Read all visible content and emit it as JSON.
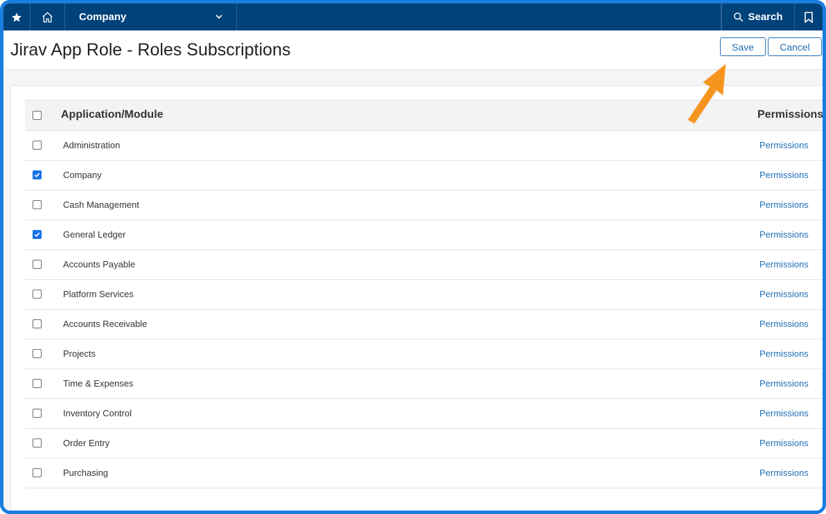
{
  "topbar": {
    "company_label": "Company",
    "search_label": "Search"
  },
  "header": {
    "title": "Jirav App Role - Roles Subscriptions",
    "save_label": "Save",
    "cancel_label": "Cancel"
  },
  "table": {
    "columns": [
      "Application/Module",
      "Permissions"
    ],
    "rows": [
      {
        "name": "Administration",
        "checked": false,
        "link": "Permissions"
      },
      {
        "name": "Company",
        "checked": true,
        "link": "Permissions"
      },
      {
        "name": "Cash Management",
        "checked": false,
        "link": "Permissions"
      },
      {
        "name": "General Ledger",
        "checked": true,
        "link": "Permissions"
      },
      {
        "name": "Accounts Payable",
        "checked": false,
        "link": "Permissions"
      },
      {
        "name": "Platform Services",
        "checked": false,
        "link": "Permissions"
      },
      {
        "name": "Accounts Receivable",
        "checked": false,
        "link": "Permissions"
      },
      {
        "name": "Projects",
        "checked": false,
        "link": "Permissions"
      },
      {
        "name": "Time & Expenses",
        "checked": false,
        "link": "Permissions"
      },
      {
        "name": "Inventory Control",
        "checked": false,
        "link": "Permissions"
      },
      {
        "name": "Order Entry",
        "checked": false,
        "link": "Permissions"
      },
      {
        "name": "Purchasing",
        "checked": false,
        "link": "Permissions"
      }
    ]
  },
  "colors": {
    "topbar": "#00427a",
    "accent": "#1f6fb5",
    "frame": "#1a7de0",
    "arrow": "#f5941f"
  }
}
